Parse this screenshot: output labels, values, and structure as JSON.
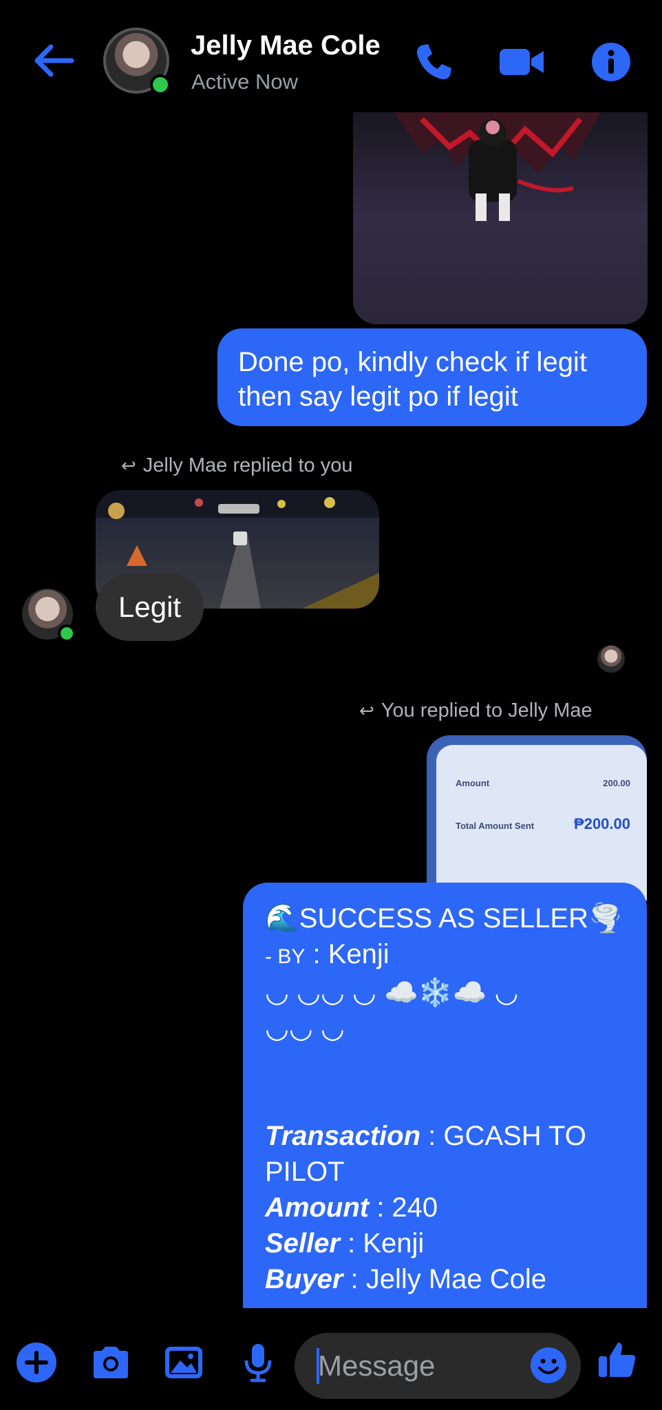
{
  "header": {
    "contact_name": "Jelly Mae Cole",
    "status": "Active Now",
    "accent": "#2d67f7",
    "online_color": "#2ec84a"
  },
  "messages": {
    "outgoing_text_1": "Done po, kindly check if legit then say legit po if legit",
    "reply_label_incoming": "Jelly Mae replied to you",
    "incoming_text": "Legit",
    "reply_label_outgoing": "You replied to Jelly Mae",
    "receipt": {
      "amount_label": "Amount",
      "amount_value": "200.00",
      "total_label": "Total Amount Sent",
      "total_value": "₱200.00"
    },
    "success": {
      "line1": "🌊SUCCESS AS SELLER🌪️",
      "by_prefix": "- BY",
      "by_sep": " : ",
      "by_name": "Kenji",
      "deco1": "◡ ◡◡ ◡ ☁️❄️☁️ ◡",
      "deco2": "◡◡ ◡",
      "transaction_key": "Transaction",
      "transaction_val": " : GCASH TO PILOT",
      "amount_key": "Amount",
      "amount_val": " : 240",
      "seller_key": "Seller",
      "seller_val": " : Kenji",
      "buyer_key": "Buyer",
      "buyer_val": " : Jelly Mae Cole"
    }
  },
  "composer": {
    "placeholder": "Message"
  },
  "icons": {
    "back": "back-arrow-icon",
    "call": "phone-icon",
    "video": "video-icon",
    "info": "info-icon",
    "plus": "plus-icon",
    "camera": "camera-icon",
    "gallery": "image-icon",
    "mic": "mic-icon",
    "emoji": "emoji-icon",
    "like": "thumbs-up-icon",
    "reply": "reply-arrow-icon"
  }
}
